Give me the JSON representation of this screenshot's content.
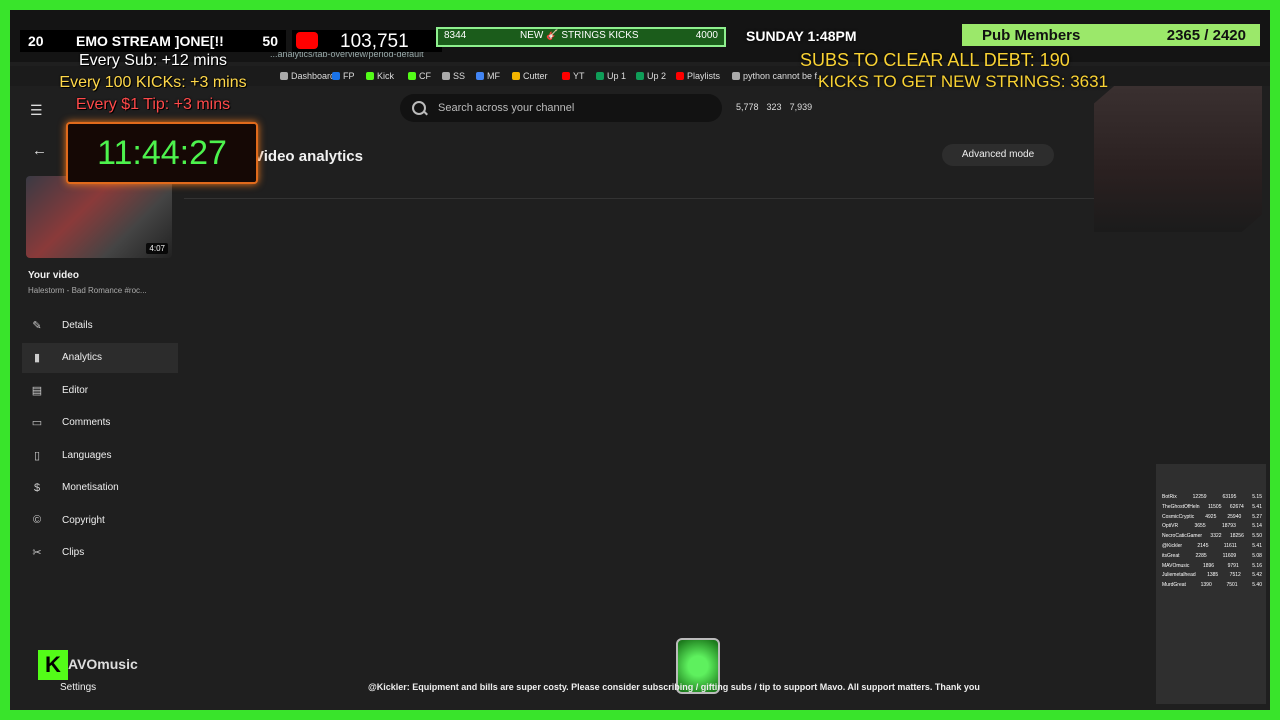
{
  "browser": {
    "url": "...analytics/tab-overview/period-default",
    "bookmarks": [
      {
        "label": "Dashboard",
        "color": "#aaaaaa"
      },
      {
        "label": "FP",
        "color": "#1a73e8"
      },
      {
        "label": "Kick",
        "color": "#53fc18"
      },
      {
        "label": "CF",
        "color": "#53fc18"
      },
      {
        "label": "SS",
        "color": "#aaaaaa"
      },
      {
        "label": "MF",
        "color": "#4285f4"
      },
      {
        "label": "Cutter",
        "color": "#f4b400"
      },
      {
        "label": "YT",
        "color": "#ff0000"
      },
      {
        "label": "Up 1",
        "color": "#0f9d58"
      },
      {
        "label": "Up 2",
        "color": "#0f9d58"
      },
      {
        "label": "Playlists",
        "color": "#ff0000"
      },
      {
        "label": "python cannot be f...",
        "color": "#aaaaaa"
      }
    ]
  },
  "studio": {
    "search_placeholder": "Search across your channel",
    "stats": [
      "5,778",
      "323",
      "7,939"
    ],
    "page_title": "Video analytics",
    "advanced_mode": "Advanced mode",
    "your_video": "Your video",
    "video_title": "Halestorm - Bad Romance #roc...",
    "video_duration": "4:07",
    "nav": [
      {
        "label": "Details",
        "icon": "✎"
      },
      {
        "label": "Analytics",
        "icon": "▮"
      },
      {
        "label": "Editor",
        "icon": "▤"
      },
      {
        "label": "Comments",
        "icon": "▭"
      },
      {
        "label": "Languages",
        "icon": "▯"
      },
      {
        "label": "Monetisation",
        "icon": "$"
      },
      {
        "label": "Copyright",
        "icon": "©"
      },
      {
        "label": "Clips",
        "icon": "✂"
      }
    ],
    "settings": "Settings"
  },
  "overlay": {
    "stream_count": "20",
    "stream_title": "EMO STREAM ]ONE[!!",
    "stream_goal": "50",
    "sub_rules": [
      "Every Sub: +12 mins",
      "Every 100 KICKs: +3 mins",
      "Every $1 Tip: +3 mins"
    ],
    "timer": "11:44:27",
    "yt_subs": "103,751",
    "kick_bar": {
      "current": "8344",
      "label": "NEW 🎸 STRINGS KICKS",
      "target": "4000"
    },
    "sunday": "SUNDAY 1:48PM",
    "pub_members": {
      "label": "Pub Members",
      "value": "2365 / 2420"
    },
    "subs_to_clear_debt": "SUBS TO CLEAR ALL DEBT: 190",
    "kicks_to_strings": "KICKS TO GET NEW STRINGS: 3631",
    "channel_name": "AVOmusic",
    "ticker": "@Kickler: Equipment and bills are super costy. Please consider subscribing / gifting subs / tip to support Mavo. All support matters. Thank you",
    "leaderboard": [
      {
        "name": "BotRix",
        "a": "12259",
        "b": "63195",
        "c": "5.15"
      },
      {
        "name": "TheGhostOfHeln",
        "a": "11505",
        "b": "62674",
        "c": "5.41"
      },
      {
        "name": "CosmicCryptic",
        "a": "4925",
        "b": "25940",
        "c": "5.27"
      },
      {
        "name": "OptiVR",
        "a": "3655",
        "b": "18793",
        "c": "5.14"
      },
      {
        "name": "NecroCaticGamer",
        "a": "3322",
        "b": "18256",
        "c": "5.50"
      },
      {
        "name": "@Kickler",
        "a": "2145",
        "b": "11611",
        "c": "5.41"
      },
      {
        "name": "itsGreat",
        "a": "2285",
        "b": "11609",
        "c": "5.08"
      },
      {
        "name": "MAVOmusic",
        "a": "1896",
        "b": "9791",
        "c": "5.16"
      },
      {
        "name": "Juliemetalhead",
        "a": "1385",
        "b": "7512",
        "c": "5.42"
      },
      {
        "name": "MurdGreat",
        "a": "1390",
        "b": "7501",
        "c": "5.40"
      }
    ]
  }
}
